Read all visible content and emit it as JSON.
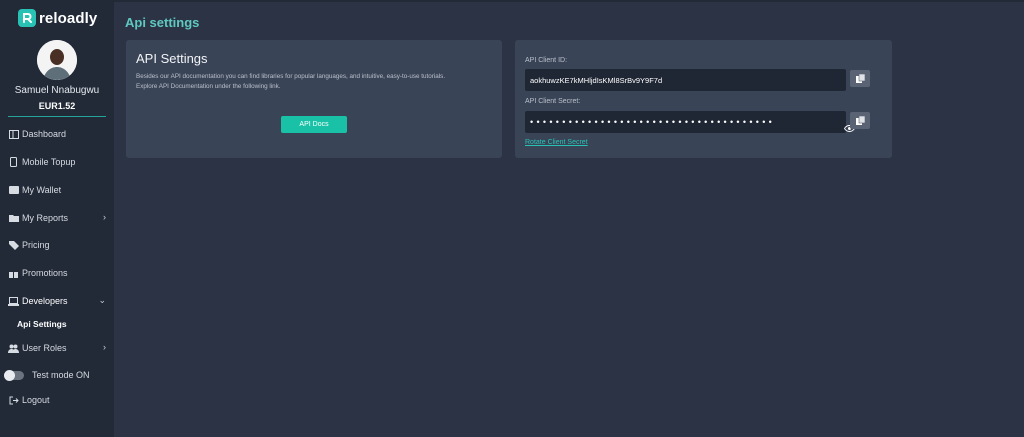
{
  "brand": {
    "name": "reloadly",
    "accent": "#27c2b4"
  },
  "user": {
    "name": "Samuel Nnabugwu",
    "balance": "EUR1.52"
  },
  "nav": [
    {
      "label": "Dashboard",
      "icon": "dashboard-icon"
    },
    {
      "label": "Mobile Topup",
      "icon": "mobile-icon"
    },
    {
      "label": "My Wallet",
      "icon": "wallet-icon"
    },
    {
      "label": "My Reports",
      "icon": "folder-icon",
      "chevron": "right"
    },
    {
      "label": "Pricing",
      "icon": "tags-icon"
    },
    {
      "label": "Promotions",
      "icon": "gift-icon"
    },
    {
      "label": "Developers",
      "icon": "laptop-icon",
      "chevron": "down"
    },
    {
      "label": "User Roles",
      "icon": "users-icon",
      "chevron": "right"
    },
    {
      "label": "Test mode ON",
      "icon": "toggle-icon"
    },
    {
      "label": "Logout",
      "icon": "logout-icon"
    }
  ],
  "nav_sub": {
    "api_settings": "Api Settings"
  },
  "page": {
    "title": "Api settings"
  },
  "api_card": {
    "title": "API Settings",
    "description_line1": "Besides our API documentation you can find libraries for popular languages, and intuitive, easy-to-use tutorials.",
    "description_line2": "Explore API Documentation under the following link.",
    "button": "API Docs"
  },
  "credentials": {
    "client_id_label": "API Client ID:",
    "client_id": "aokhuwzKE7kMHljdIsKMl8SrBv9Y9F7d",
    "client_secret_label": "API Client Secret:",
    "client_secret_masked": "••••••••••••••••••••••••••••••••••••••",
    "rotate_link": "Rotate Client Secret"
  }
}
